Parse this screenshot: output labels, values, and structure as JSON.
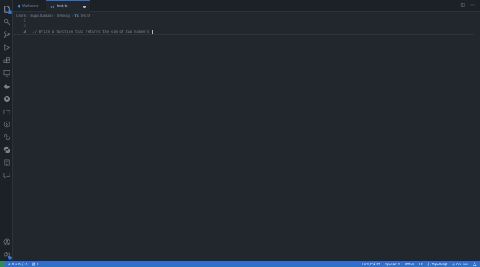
{
  "tabs": {
    "welcome": "Welcome",
    "active_file": "test.ts",
    "lang_badge": "TS"
  },
  "breadcrumb": [
    "Users",
    "majid.hussain",
    "Desktop",
    "test.ts"
  ],
  "editor": {
    "lines": [
      {
        "number": "1",
        "text": ""
      },
      {
        "number": "2",
        "text": ""
      },
      {
        "number": "3",
        "text": "// Write a function that returns the sum of two numbers."
      }
    ]
  },
  "status": {
    "errors": "0",
    "warnings": "0",
    "info": "0",
    "ports": "0",
    "position": "Ln 3, Col 57",
    "spaces": "Spaces: 2",
    "encoding": "UTF-8",
    "eol": "LF",
    "braces": "{ }",
    "language": "TypeScript",
    "golive": "Go Live"
  },
  "activity": {
    "explorer_badge": "1",
    "settings_badge": "1"
  },
  "colors": {
    "accent": "#316dca",
    "background": "#22272e",
    "sidebar": "#1c2128"
  }
}
